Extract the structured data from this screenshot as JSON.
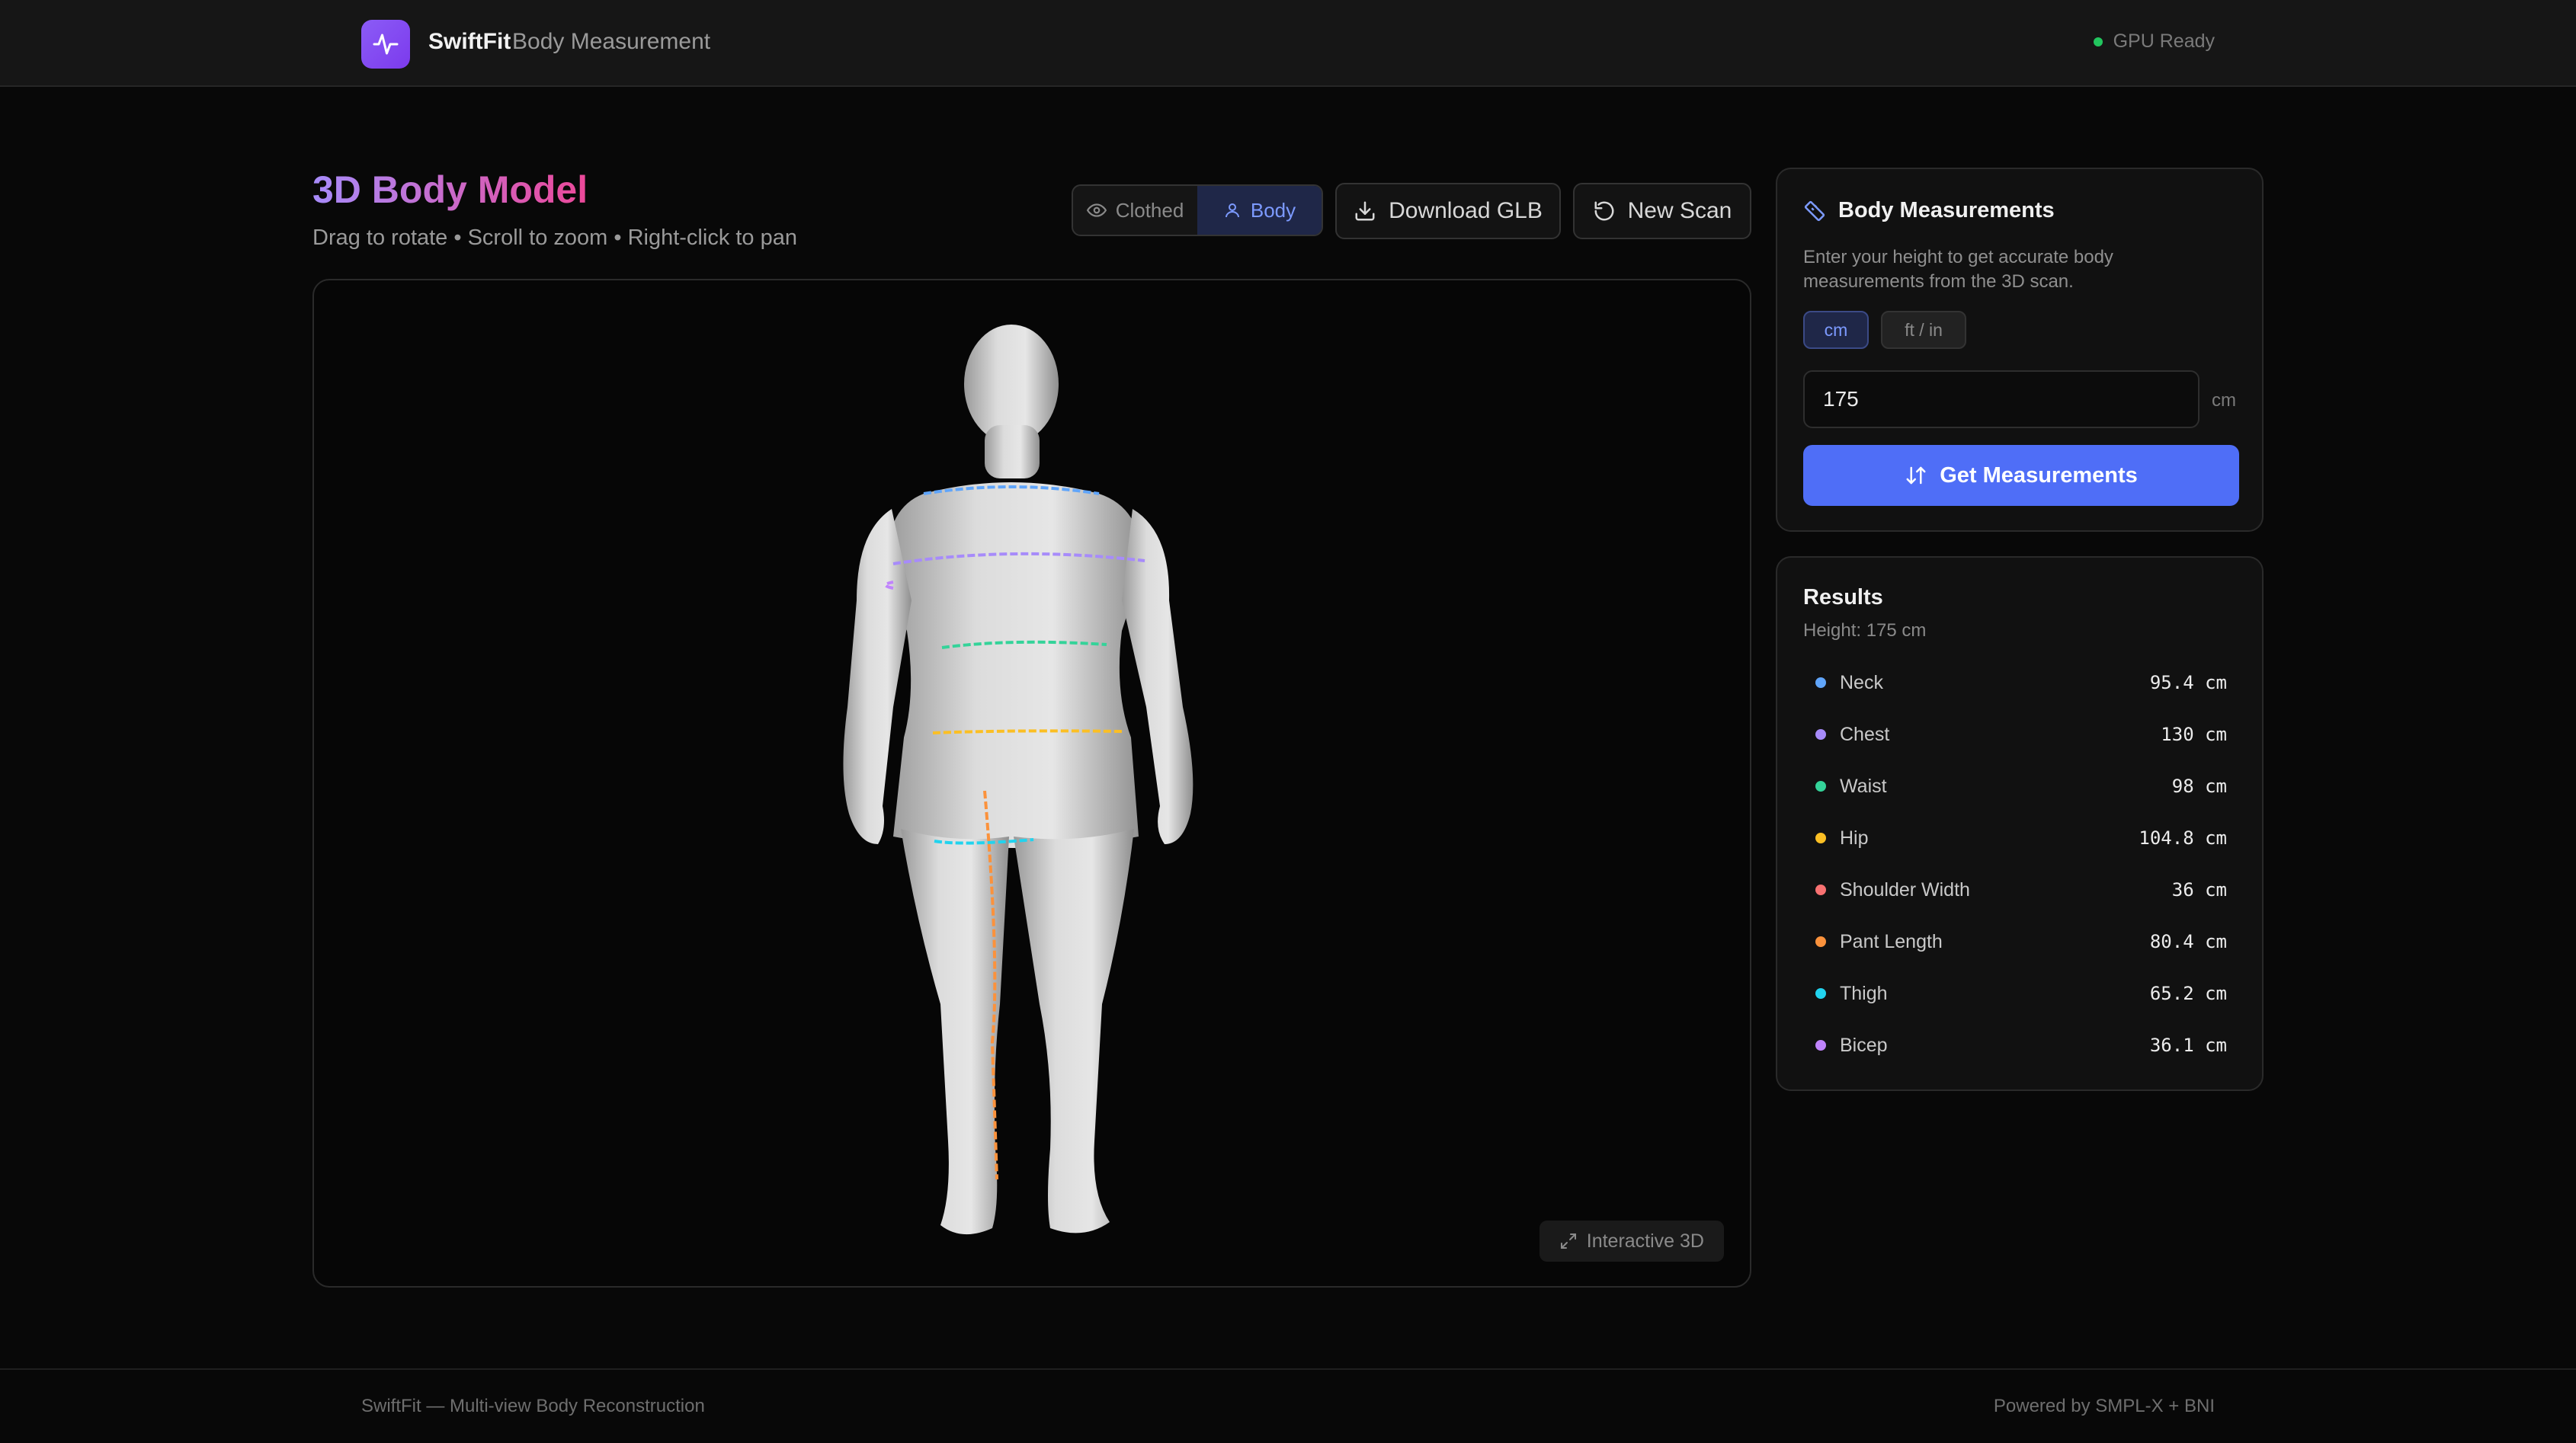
{
  "header": {
    "brand": "SwiftFit",
    "brand_sub": "Body Measurement",
    "status": "GPU Ready",
    "status_color": "#22c55e"
  },
  "page": {
    "title": "3D Body Model",
    "subtitle": "Drag to rotate • Scroll to zoom • Right-click to pan"
  },
  "toolbar": {
    "view_modes": [
      {
        "label": "Clothed",
        "icon": "eye-icon",
        "active": false
      },
      {
        "label": "Body",
        "icon": "person-icon",
        "active": true
      }
    ],
    "download_label": "Download GLB",
    "new_scan_label": "New Scan"
  },
  "viewer": {
    "badge": "Interactive 3D"
  },
  "measure_panel": {
    "title": "Body Measurements",
    "description": "Enter your height to get accurate body measurements from the 3D scan.",
    "unit_options": [
      "cm",
      "ft / in"
    ],
    "selected_unit": "cm",
    "height_value": "175",
    "input_unit": "cm",
    "button_label": "Get Measurements",
    "accent": "#4f6ef7"
  },
  "results": {
    "title": "Results",
    "height_label": "Height: 175 cm",
    "items": [
      {
        "name": "Neck",
        "value": "95.4 cm",
        "color": "#60a5fa"
      },
      {
        "name": "Chest",
        "value": "130 cm",
        "color": "#a78bfa"
      },
      {
        "name": "Waist",
        "value": "98 cm",
        "color": "#34d399"
      },
      {
        "name": "Hip",
        "value": "104.8 cm",
        "color": "#fbbf24"
      },
      {
        "name": "Shoulder Width",
        "value": "36 cm",
        "color": "#f87171"
      },
      {
        "name": "Pant Length",
        "value": "80.4 cm",
        "color": "#fb923c"
      },
      {
        "name": "Thigh",
        "value": "65.2 cm",
        "color": "#22d3ee"
      },
      {
        "name": "Bicep",
        "value": "36.1 cm",
        "color": "#c084fc"
      }
    ]
  },
  "footer": {
    "left": "SwiftFit — Multi-view Body Reconstruction",
    "right": "Powered by SMPL-X + BNI"
  }
}
